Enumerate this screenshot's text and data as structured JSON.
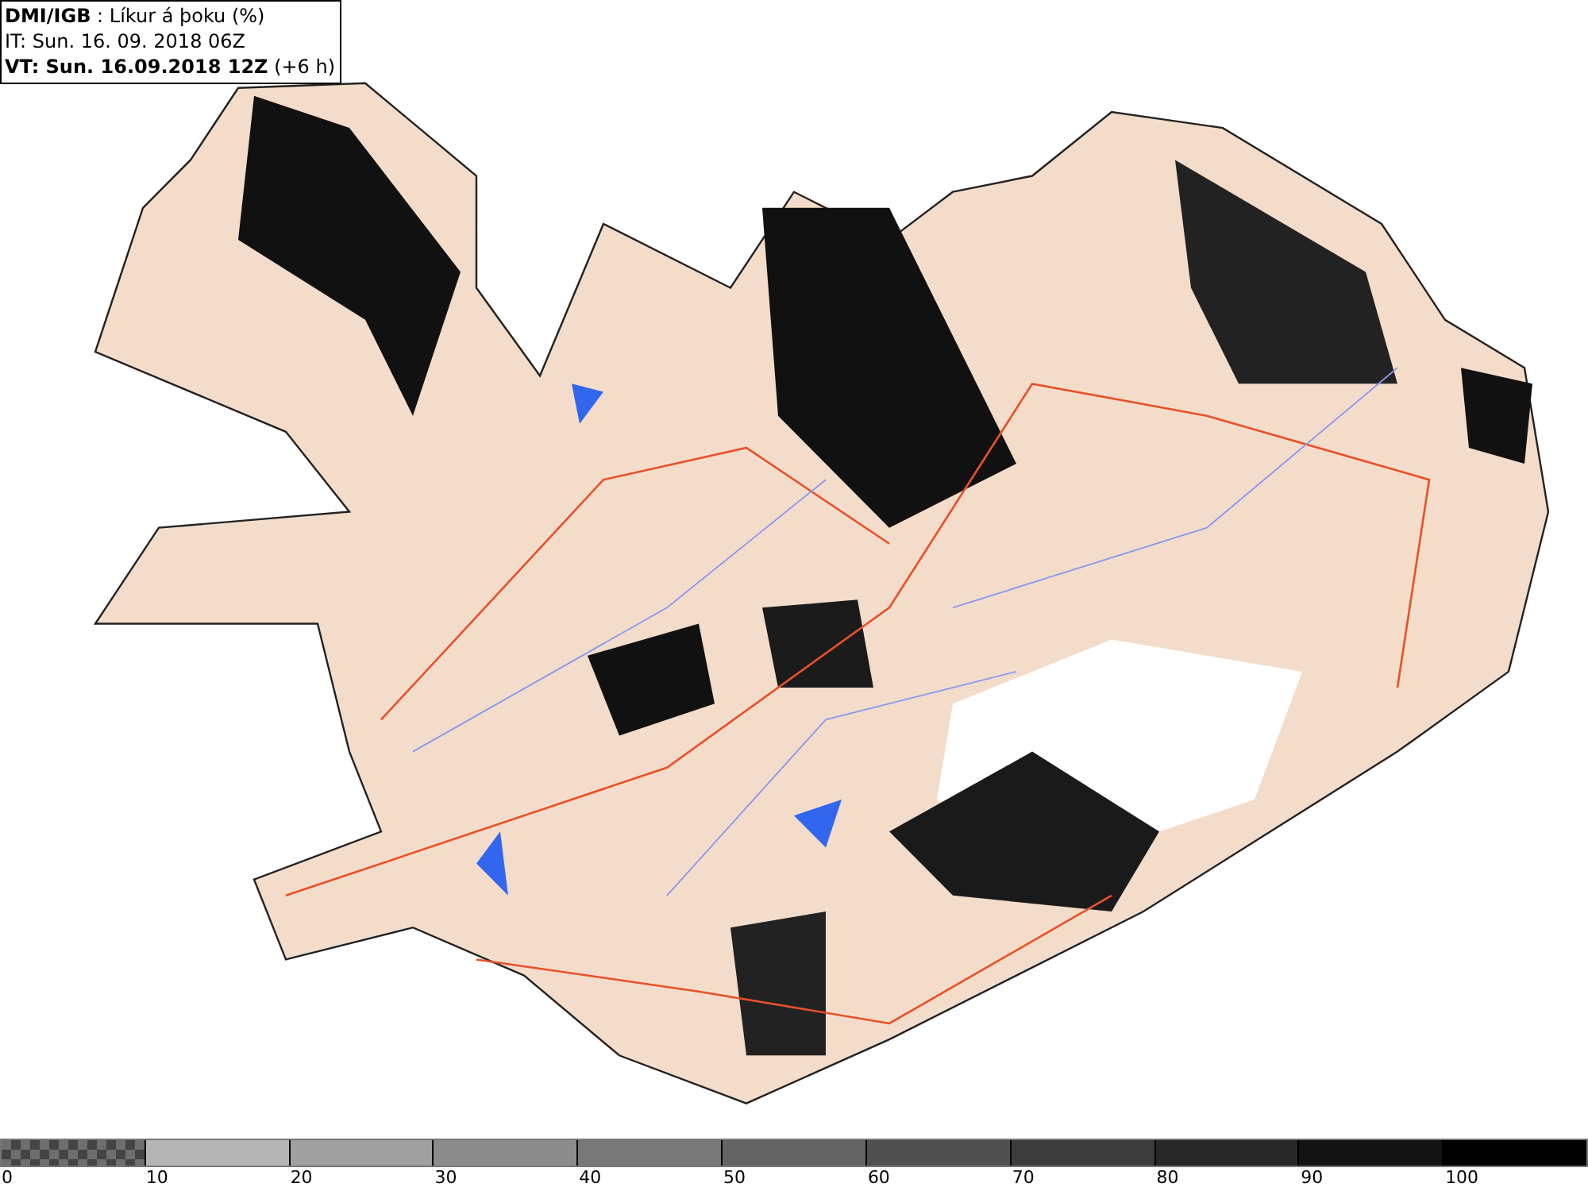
{
  "header": {
    "title": "**DMI/IGB** : Líkur á þoku (%)",
    "initial_time": "IT: Sun. 16. 09. 2018 06Z",
    "valid_time": "**VT: Sun. 16.09.2018 12Z** (+6 h)"
  },
  "legend": {
    "segments": [
      {
        "kind": "checker",
        "color": "#6e6e6e"
      },
      {
        "kind": "solid",
        "color": "#b4b4b4"
      },
      {
        "kind": "solid",
        "color": "#a0a0a0"
      },
      {
        "kind": "solid",
        "color": "#8c8c8c"
      },
      {
        "kind": "solid",
        "color": "#787878"
      },
      {
        "kind": "solid",
        "color": "#646464"
      },
      {
        "kind": "solid",
        "color": "#505050"
      },
      {
        "kind": "solid",
        "color": "#3c3c3c"
      },
      {
        "kind": "solid",
        "color": "#282828"
      },
      {
        "kind": "solid",
        "color": "#141414"
      },
      {
        "kind": "solid",
        "color": "#000000"
      }
    ],
    "labels": [
      "0",
      "10",
      "20",
      "30",
      "40",
      "50",
      "60",
      "70",
      "80",
      "90",
      "100"
    ]
  }
}
